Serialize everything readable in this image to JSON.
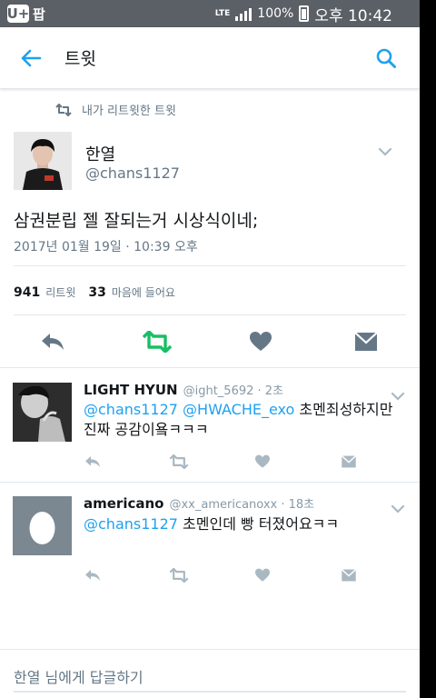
{
  "status_bar": {
    "carrier_badge": "U+",
    "app_badge": "팝",
    "network": "LTE",
    "battery": "100%",
    "time": "오후 10:42"
  },
  "header": {
    "title": "트윗"
  },
  "retweet_context": "내가 리트윗한 트윗",
  "tweet": {
    "name": "한열",
    "handle": "@chans1127",
    "text": "삼권분립 젤 잘되는거 시상식이네;",
    "timestamp": "2017년 01월 19일 · 10:39 오후",
    "retweets_count": "941",
    "retweets_label": "리트윗",
    "likes_count": "33",
    "likes_label": "마음에 들어요"
  },
  "replies": [
    {
      "name": "LIGHT HYUN",
      "meta": "@ight_5692 · 2초",
      "mention1": "@chans1127",
      "mention2": "@HWACHE_exo",
      "text": "초멘죄성하지만 진짜 공감이욬ㅋㅋㅋ"
    },
    {
      "name": "americano",
      "meta": "@xx_americanoxx · 18초",
      "mention1": "@chans1127",
      "text": "초멘인데 빵 터졌어요ㅋㅋ"
    }
  ],
  "compose": {
    "placeholder": "한열 님에게 답글하기"
  },
  "colors": {
    "accent": "#1da1f2",
    "retweet_active": "#17bf63",
    "icon_gray": "#657786",
    "icon_light": "#aab8c2",
    "status_bar": "#5b6066"
  },
  "icons": [
    "arrow-left-icon",
    "search-icon",
    "retweet-icon",
    "chevron-down-icon",
    "reply-icon",
    "heart-icon",
    "dm-icon"
  ]
}
